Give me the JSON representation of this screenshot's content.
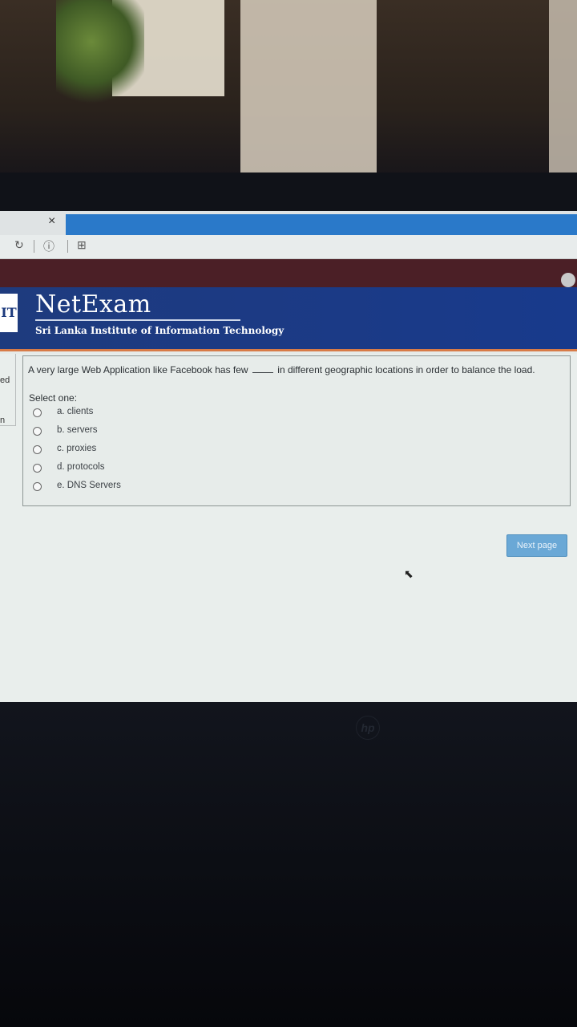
{
  "browser": {
    "close_glyph": "×",
    "reload_icon": "reload-icon",
    "info_icon": "info-icon",
    "page_icon": "page-action-icon"
  },
  "header": {
    "logo_letters": "IT",
    "brand": "NetExam",
    "institute": "Sri Lanka Institute of Information Technology"
  },
  "sidebar": {
    "fragment_1": "ed",
    "fragment_2": "n"
  },
  "question": {
    "text_before": "A very large Web Application like Facebook  has few",
    "text_after": "in different geographic locations in order to balance the load.",
    "select_label": "Select one:",
    "options": [
      {
        "label": "a. clients",
        "selected": false
      },
      {
        "label": "b. servers",
        "selected": false
      },
      {
        "label": "c. proxies",
        "selected": false
      },
      {
        "label": "d. protocols",
        "selected": false
      },
      {
        "label": "e. DNS Servers",
        "selected": false
      }
    ]
  },
  "navigation": {
    "next_label": "Next page"
  },
  "hardware": {
    "logo": "hp"
  }
}
